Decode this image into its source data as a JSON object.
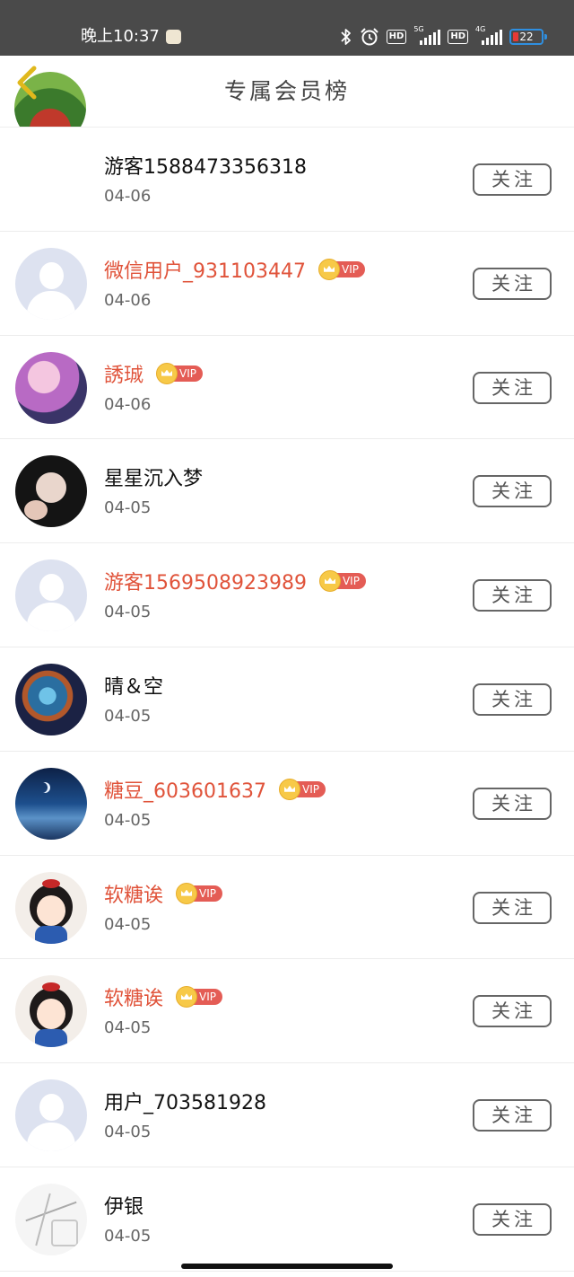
{
  "status_bar": {
    "time": "晚上10:37",
    "network_1": "5G",
    "network_2": "4G",
    "hd_label": "HD",
    "battery": "22",
    "icons": [
      "bluetooth-icon",
      "alarm-icon",
      "signal-icon",
      "battery-icon"
    ]
  },
  "header": {
    "title": "专属会员榜",
    "back_icon": "chevron-left-icon"
  },
  "colors": {
    "vip_name": "#e0533a",
    "vip_badge": "#e45c55",
    "crown": "#f7c948",
    "back_arrow": "#e0b81c"
  },
  "vip_label": "VIP",
  "follow_label": "关注",
  "members": [
    {
      "name": "游客1588473356318",
      "date": "04-06",
      "vip": false,
      "avatar": "photo"
    },
    {
      "name": "微信用户_931103447",
      "date": "04-06",
      "vip": true,
      "avatar": "default"
    },
    {
      "name": "誘珹",
      "date": "04-06",
      "vip": true,
      "avatar": "anime"
    },
    {
      "name": "星星沉入梦",
      "date": "04-05",
      "vip": false,
      "avatar": "girl"
    },
    {
      "name": "游客1569508923989",
      "date": "04-05",
      "vip": true,
      "avatar": "default"
    },
    {
      "name": "晴＆空",
      "date": "04-05",
      "vip": false,
      "avatar": "nebula"
    },
    {
      "name": "糖豆_603601637",
      "date": "04-05",
      "vip": true,
      "avatar": "night"
    },
    {
      "name": "软糖诶",
      "date": "04-05",
      "vip": true,
      "avatar": "cartoon"
    },
    {
      "name": "软糖诶",
      "date": "04-05",
      "vip": true,
      "avatar": "cartoon"
    },
    {
      "name": "用户_703581928",
      "date": "04-05",
      "vip": false,
      "avatar": "default"
    },
    {
      "name": "伊银",
      "date": "04-05",
      "vip": false,
      "avatar": "sketch"
    }
  ]
}
